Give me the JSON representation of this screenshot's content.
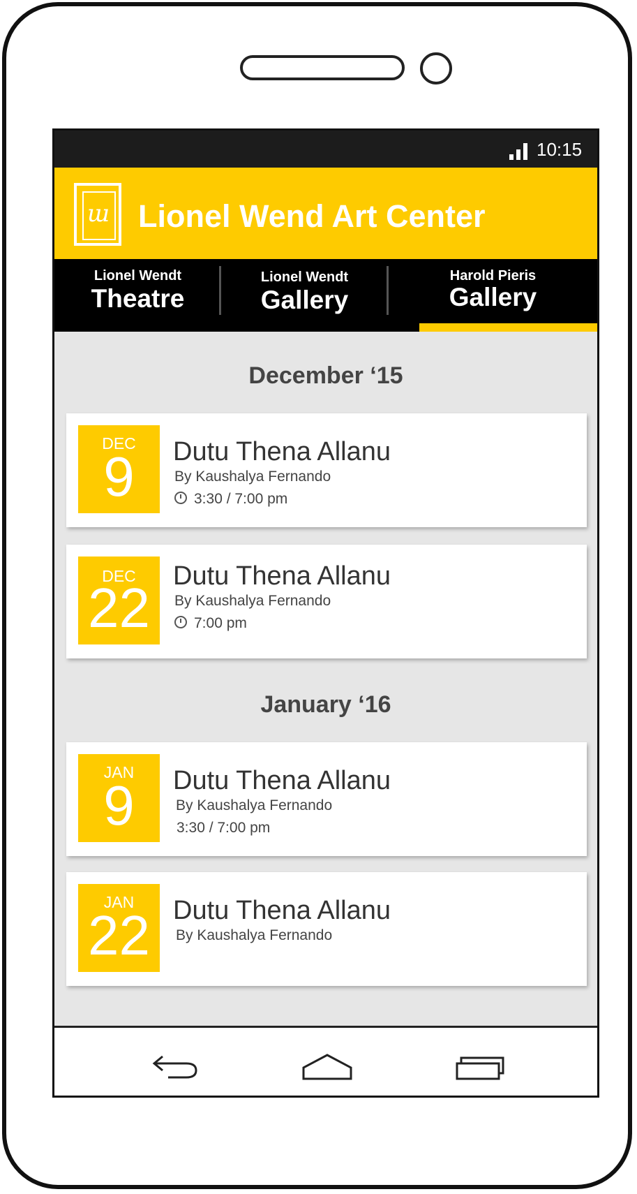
{
  "status_bar": {
    "time": "10:15"
  },
  "app_bar": {
    "title": "Lionel Wend Art Center",
    "logo_icon": "lionel-wendt-logo-icon"
  },
  "tabs": [
    {
      "sub": "Lionel Wendt",
      "main": "Theatre",
      "selected": false
    },
    {
      "sub": "Lionel Wendt",
      "main": "Gallery",
      "selected": false
    },
    {
      "sub": "Harold Pieris",
      "main": "Gallery",
      "selected": true
    }
  ],
  "sections": [
    {
      "month": "December ‘15",
      "events": [
        {
          "month": "DEC",
          "day": "9",
          "title": "Dutu Thena Allanu",
          "by": "By Kaushalya Fernando",
          "time": "3:30 / 7:00 pm",
          "alarm_icon": true
        },
        {
          "month": "DEC",
          "day": "22",
          "title": "Dutu Thena Allanu",
          "by": "By Kaushalya Fernando",
          "time": "7:00 pm",
          "alarm_icon": true
        }
      ]
    },
    {
      "month": "January ‘16",
      "events": [
        {
          "month": "JAN",
          "day": "9",
          "title": "Dutu Thena Allanu",
          "by": "By Kaushalya Fernando",
          "time": "3:30 / 7:00 pm",
          "alarm_icon": false
        },
        {
          "month": "JAN",
          "day": "22",
          "title": "Dutu Thena Allanu",
          "by": "By Kaushalya Fernando",
          "time": "",
          "alarm_icon": false
        }
      ]
    }
  ],
  "nav_bar": {
    "icons": [
      "back-icon",
      "home-icon",
      "recents-icon"
    ]
  },
  "colors": {
    "accent": "#fecb00",
    "tab_background": "#000000",
    "status_bar": "#1c1c1c",
    "content_background": "#e6e6e6"
  }
}
